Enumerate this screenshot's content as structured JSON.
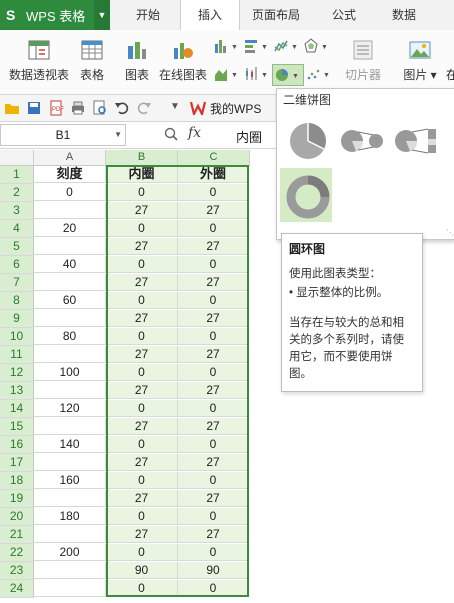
{
  "app": {
    "name": "WPS 表格",
    "logo": "S"
  },
  "menu_tabs": [
    "开始",
    "插入",
    "页面布局",
    "公式",
    "数据"
  ],
  "active_tab": "插入",
  "ribbon": {
    "pivot_label": "数据透视表",
    "table_label": "表格",
    "chart_label": "图表",
    "online_chart_label": "在线图表",
    "slicer_label": "切片器",
    "picture_label": "图片",
    "more_label": "在"
  },
  "qat": {
    "mywps_label": "我的WPS"
  },
  "formula_bar": {
    "name_box": "B1",
    "fx": "fx",
    "value": "内圈"
  },
  "columns": [
    "A",
    "B",
    "C"
  ],
  "rows": [
    [
      "刻度",
      "内圈",
      "外圈"
    ],
    [
      "0",
      "0",
      "0"
    ],
    [
      "",
      "27",
      "27"
    ],
    [
      "20",
      "0",
      "0"
    ],
    [
      "",
      "27",
      "27"
    ],
    [
      "40",
      "0",
      "0"
    ],
    [
      "",
      "27",
      "27"
    ],
    [
      "60",
      "0",
      "0"
    ],
    [
      "",
      "27",
      "27"
    ],
    [
      "80",
      "0",
      "0"
    ],
    [
      "",
      "27",
      "27"
    ],
    [
      "100",
      "0",
      "0"
    ],
    [
      "",
      "27",
      "27"
    ],
    [
      "120",
      "0",
      "0"
    ],
    [
      "",
      "27",
      "27"
    ],
    [
      "140",
      "0",
      "0"
    ],
    [
      "",
      "27",
      "27"
    ],
    [
      "160",
      "0",
      "0"
    ],
    [
      "",
      "27",
      "27"
    ],
    [
      "180",
      "0",
      "0"
    ],
    [
      "",
      "27",
      "27"
    ],
    [
      "200",
      "0",
      "0"
    ],
    [
      "",
      "90",
      "90"
    ],
    [
      "",
      "0",
      "0"
    ]
  ],
  "row_numbers": [
    "1",
    "2",
    "3",
    "4",
    "5",
    "6",
    "7",
    "8",
    "9",
    "10",
    "11",
    "12",
    "13",
    "14",
    "15",
    "16",
    "17",
    "18",
    "19",
    "20",
    "21",
    "22",
    "23",
    "24"
  ],
  "chart_panel": {
    "title": "二维饼图",
    "tooltip_title": "圆环图",
    "tooltip_line1": "使用此图表类型：",
    "tooltip_line2": "• 显示整体的比例。",
    "tooltip_desc": "当存在与较大的总和相关的多个系列时，请使用它，而不要使用饼图。"
  },
  "colors": {
    "accent": "#2e8b3e",
    "selection_fill": "#eaf5e1",
    "selection_border": "#3b8b3b"
  }
}
